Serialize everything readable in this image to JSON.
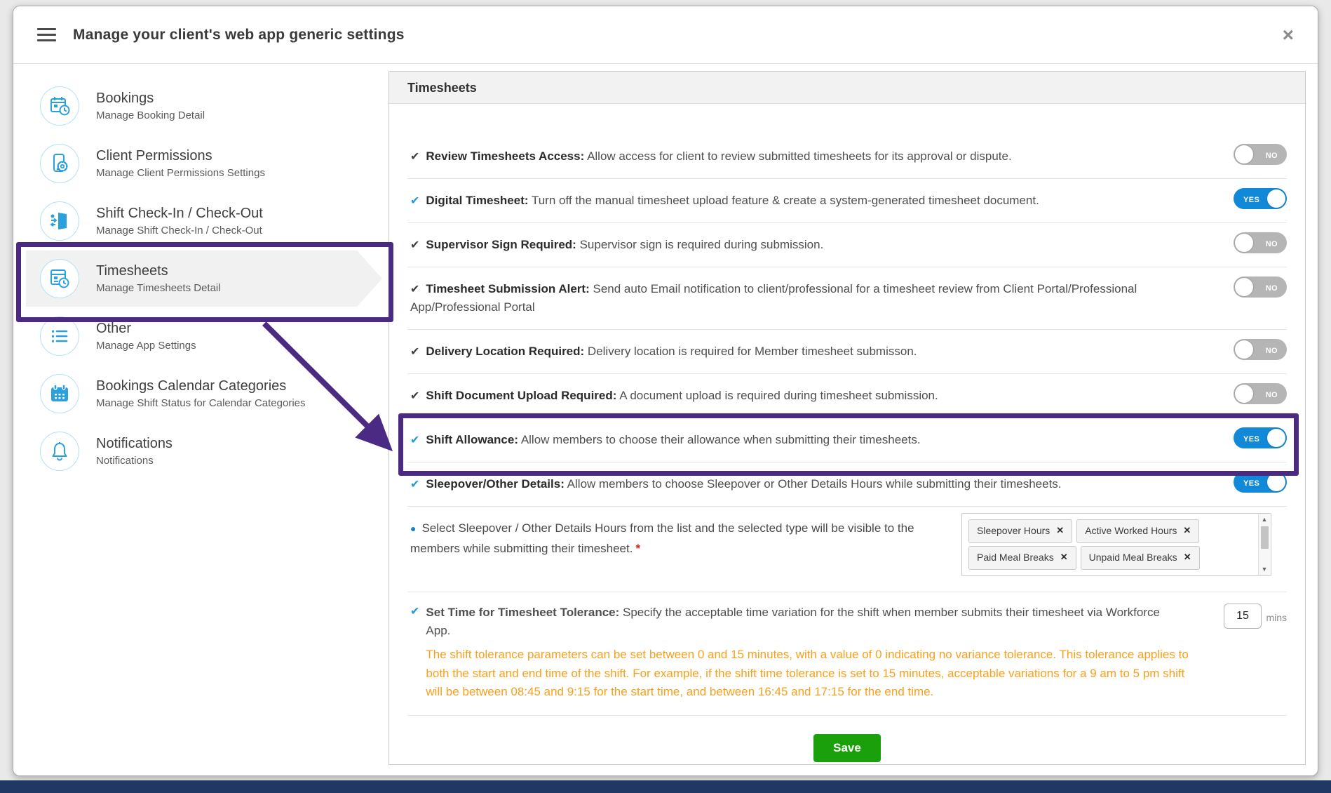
{
  "colors": {
    "accent_purple": "#4a2a82",
    "toggle_on_blue": "#1289d8",
    "toggle_off_gray": "#b5b5b5",
    "save_green": "#1aa00a",
    "note_orange": "#f8a01c",
    "navy_bar": "#1f3864",
    "selected_item_gray": "#f1f1f1"
  },
  "icons": {
    "close": "×",
    "check": "✔",
    "remove": "✕",
    "bullet": "●",
    "scroll_up_arrow": "▲",
    "scroll_down_arrow": "▼"
  },
  "header": {
    "title": "Manage your client's web app generic settings"
  },
  "sidebar": {
    "items": [
      {
        "title": "Bookings",
        "subtitle": "Manage Booking Detail",
        "icon": "calendar-clock-icon",
        "selected": false
      },
      {
        "title": "Client Permissions",
        "subtitle": "Manage Client Permissions Settings",
        "icon": "phone-gear-icon",
        "selected": false
      },
      {
        "title": "Shift Check-In / Check-Out",
        "subtitle": "Manage Shift Check-In / Check-Out",
        "icon": "door-check-icon",
        "selected": false
      },
      {
        "title": "Timesheets",
        "subtitle": "Manage Timesheets Detail",
        "icon": "timesheet-clock-icon",
        "selected": true
      },
      {
        "title": "Other",
        "subtitle": "Manage App Settings",
        "icon": "list-icon",
        "selected": false
      },
      {
        "title": "Bookings Calendar Categories",
        "subtitle": "Manage Shift Status for Calendar Categories",
        "icon": "calendar-solid-icon",
        "selected": false
      },
      {
        "title": "Notifications",
        "subtitle": "Notifications",
        "icon": "bell-icon",
        "selected": false
      }
    ]
  },
  "panel": {
    "title": "Timesheets",
    "rows": [
      {
        "label": "Review Timesheets Access:",
        "description": "Allow access for client to review submitted timesheets for its approval or dispute.",
        "toggle": "NO",
        "check_color": "dark",
        "highlighted": false
      },
      {
        "label": "Digital Timesheet:",
        "description": "Turn off the manual timesheet upload feature & create a system-generated timesheet document.",
        "toggle": "YES",
        "check_color": "blue",
        "highlighted": false
      },
      {
        "label": "Supervisor Sign Required:",
        "description": "Supervisor sign is required during submission.",
        "toggle": "NO",
        "check_color": "dark",
        "highlighted": false
      },
      {
        "label": "Timesheet Submission Alert:",
        "description": "Send auto Email notification to client/professional for a timesheet review from Client Portal/Professional App/Professional Portal",
        "toggle": "NO",
        "check_color": "dark",
        "highlighted": false
      },
      {
        "label": "Delivery Location Required:",
        "description": "Delivery location is required for Member timesheet submisson.",
        "toggle": "NO",
        "check_color": "dark",
        "highlighted": false
      },
      {
        "label": "Shift Document Upload Required:",
        "description": "A document upload is required during timesheet submission.",
        "toggle": "NO",
        "check_color": "dark",
        "highlighted": false
      },
      {
        "label": "Shift Allowance:",
        "description": "Allow members to choose their allowance when submitting their timesheets.",
        "toggle": "YES",
        "check_color": "blue",
        "highlighted": true
      },
      {
        "label": "Sleepover/Other Details:",
        "description": "Allow members to choose Sleepover or Other Details Hours while submitting their timesheets.",
        "toggle": "YES",
        "check_color": "blue",
        "highlighted": false
      }
    ],
    "sleepover_select": {
      "text": "Select Sleepover / Other Details Hours from the list and the selected type will be visible to the members while submitting their timesheet.",
      "required_mark": "*",
      "tags": [
        "Sleepover Hours",
        "Active Worked Hours",
        "Paid Meal Breaks",
        "Unpaid Meal Breaks"
      ]
    },
    "tolerance": {
      "label": "Set Time for Timesheet Tolerance:",
      "description": "Specify the acceptable time variation for the shift when member submits their timesheet via Workforce App.",
      "note": "The shift tolerance parameters can be set between 0 and 15 minutes, with a value of 0 indicating no variance tolerance. This tolerance applies to both the start and end time of the shift. For example, if the shift time tolerance is set to 15 minutes, acceptable variations for a 9 am to 5 pm shift will be between 08:45 and 9:15 for the start time, and between 16:45 and 17:15 for the end time.",
      "value": "15",
      "unit": "mins"
    },
    "save_label": "Save"
  }
}
